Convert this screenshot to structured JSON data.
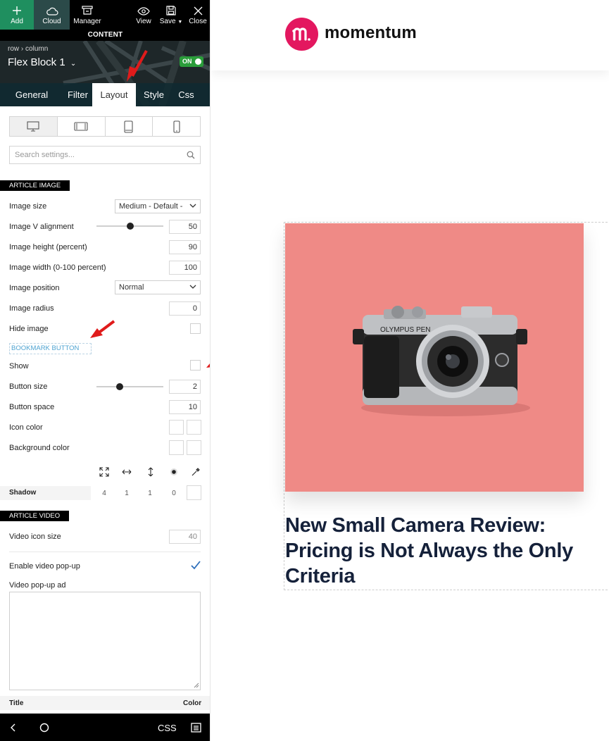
{
  "topbar": {
    "add": "Add",
    "cloud": "Cloud",
    "manager": "Manager",
    "view": "View",
    "save": "Save",
    "close": "Close"
  },
  "content_strip": "CONTENT",
  "hero": {
    "crumb_row": "row",
    "crumb_sep": "›",
    "crumb_column": "column",
    "block_title": "Flex Block 1",
    "toggle": "ON"
  },
  "tabs": [
    "General",
    "Filter",
    "Layout",
    "Style",
    "Css"
  ],
  "search": {
    "placeholder": "Search settings..."
  },
  "article_image": {
    "header": "ARTICLE IMAGE",
    "image_size_label": "Image size",
    "image_size_value": "Medium - Default -",
    "v_align_label": "Image V alignment",
    "v_align_value": "50",
    "height_label": "Image height (percent)",
    "height_value": "90",
    "width_label": "Image width (0-100 percent)",
    "width_value": "100",
    "position_label": "Image position",
    "position_value": "Normal",
    "radius_label": "Image radius",
    "radius_value": "0",
    "hide_label": "Hide image"
  },
  "bookmark": {
    "header": "BOOKMARK BUTTON",
    "show_label": "Show",
    "size_label": "Button size",
    "size_value": "2",
    "space_label": "Button space",
    "space_value": "10",
    "icon_color_label": "Icon color",
    "bg_color_label": "Background color"
  },
  "shadow": {
    "label": "Shadow",
    "values": [
      "4",
      "1",
      "1",
      "0"
    ]
  },
  "article_video": {
    "header": "ARTICLE VIDEO",
    "icon_size_label": "Video icon size",
    "icon_size_value": "40",
    "popup_label": "Enable video pop-up",
    "popup_ad_label": "Video pop-up ad"
  },
  "title_row": {
    "title": "Title",
    "color": "Color"
  },
  "bottombar": {
    "css": "CSS"
  },
  "preview": {
    "logo_text": "momentum",
    "article_title": "New Small Camera Review: Pricing is Not Always the Only Criteria",
    "camera_brand": "OLYMPUS PEN"
  },
  "colors": {
    "accent_green": "#1f8f5f",
    "toggle_green": "#2a9d3a",
    "logo_pink": "#e3175f",
    "image_bg": "#ef8a86",
    "title_navy": "#15213a",
    "arrow_red": "#e01b1b"
  }
}
